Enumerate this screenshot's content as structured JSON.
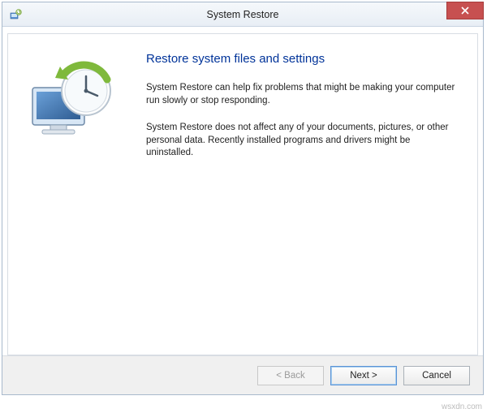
{
  "window": {
    "title": "System Restore"
  },
  "content": {
    "heading": "Restore system files and settings",
    "para1": "System Restore can help fix problems that might be making your computer run slowly or stop responding.",
    "para2": "System Restore does not affect any of your documents, pictures, or other personal data. Recently installed programs and drivers might be uninstalled."
  },
  "buttons": {
    "back": "< Back",
    "next": "Next >",
    "cancel": "Cancel"
  },
  "watermark": "wsxdn.com"
}
